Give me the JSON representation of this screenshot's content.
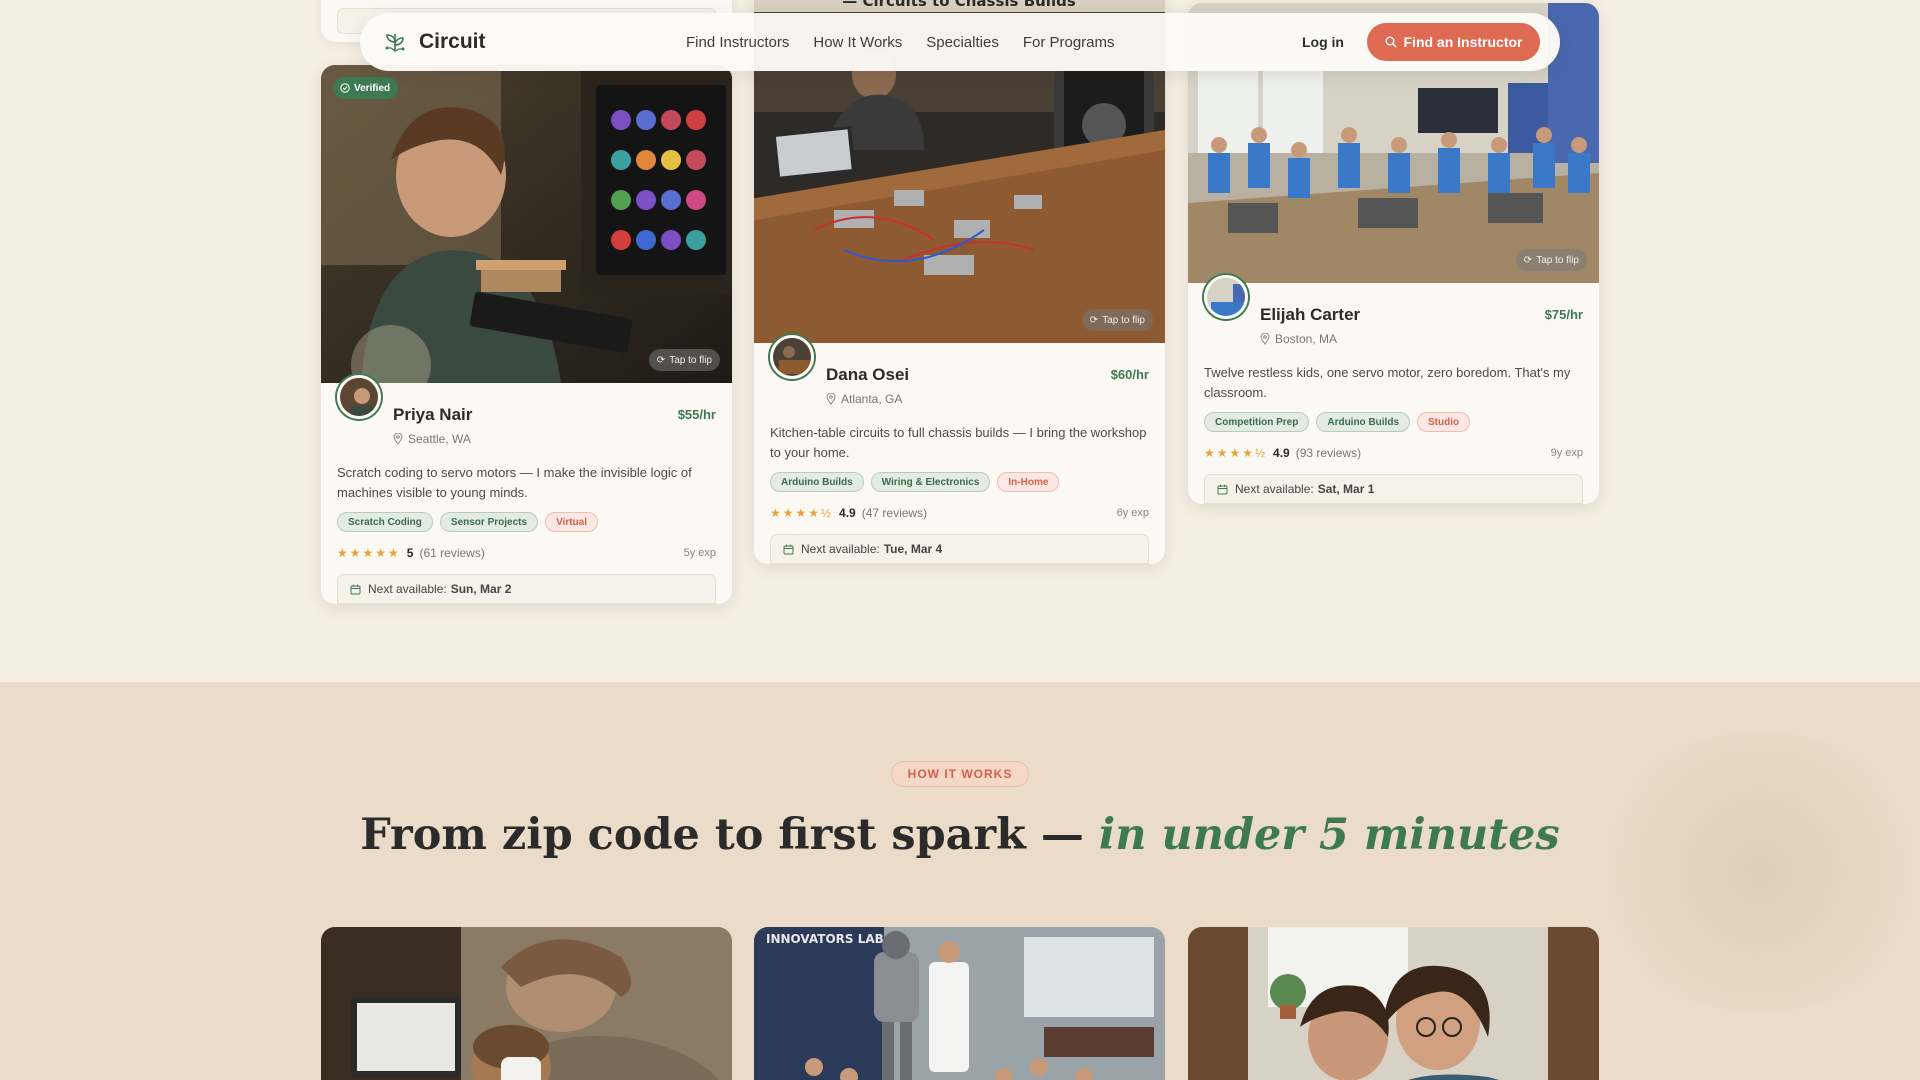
{
  "brand": {
    "name": "Circuit",
    "logo_icon": "circuit-leaf-icon"
  },
  "nav": {
    "links": [
      "Find Instructors",
      "How It Works",
      "Specialties",
      "For Programs"
    ],
    "login": "Log in",
    "cta": "Find an Instructor"
  },
  "cards": [
    {
      "verified": "Verified",
      "flip": "Tap to flip",
      "name": "Priya Nair",
      "rate": "$55/hr",
      "location": "Seattle, WA",
      "bio": "Scratch coding to servo motors — I make the invisible logic of machines visible to young minds.",
      "tags": [
        {
          "label": "Scratch Coding",
          "style": "green"
        },
        {
          "label": "Sensor Projects",
          "style": "green"
        },
        {
          "label": "Virtual",
          "style": "red"
        }
      ],
      "stars": "★★★★★",
      "rating": "5",
      "reviews": "(61 reviews)",
      "experience": "5y exp",
      "avail_label": "Next available:",
      "avail_date": "Sun, Mar 2"
    },
    {
      "image_caption": "— Circuits to Chassis Builds",
      "flip": "Tap to flip",
      "name": "Dana Osei",
      "rate": "$60/hr",
      "location": "Atlanta, GA",
      "bio": "Kitchen-table circuits to full chassis builds — I bring the workshop to your home.",
      "tags": [
        {
          "label": "Arduino Builds",
          "style": "green"
        },
        {
          "label": "Wiring & Electronics",
          "style": "green"
        },
        {
          "label": "In-Home",
          "style": "red"
        }
      ],
      "stars": "★★★★½",
      "rating": "4.9",
      "reviews": "(47 reviews)",
      "experience": "6y exp",
      "avail_label": "Next available:",
      "avail_date": "Tue, Mar 4"
    },
    {
      "flip": "Tap to flip",
      "name": "Elijah Carter",
      "rate": "$75/hr",
      "location": "Boston, MA",
      "bio": "Twelve restless kids, one servo motor, zero boredom. That's my classroom.",
      "tags": [
        {
          "label": "Competition Prep",
          "style": "green"
        },
        {
          "label": "Arduino Builds",
          "style": "green"
        },
        {
          "label": "Studio",
          "style": "red"
        }
      ],
      "stars": "★★★★½",
      "rating": "4.9",
      "reviews": "(93 reviews)",
      "experience": "9y exp",
      "avail_label": "Next available:",
      "avail_date": "Sat, Mar 1"
    }
  ],
  "how": {
    "pill": "HOW IT WORKS",
    "title_plain": "From zip code to first spark — ",
    "title_accent": "in under 5 minutes",
    "step_image_2_caption": "INNOVATORS LAB"
  },
  "colors": {
    "accent_green": "#3d7a52",
    "accent_coral": "#df6a54",
    "background": "#f5eee3",
    "how_background": "#eadcc8",
    "star": "#e7a43a"
  }
}
